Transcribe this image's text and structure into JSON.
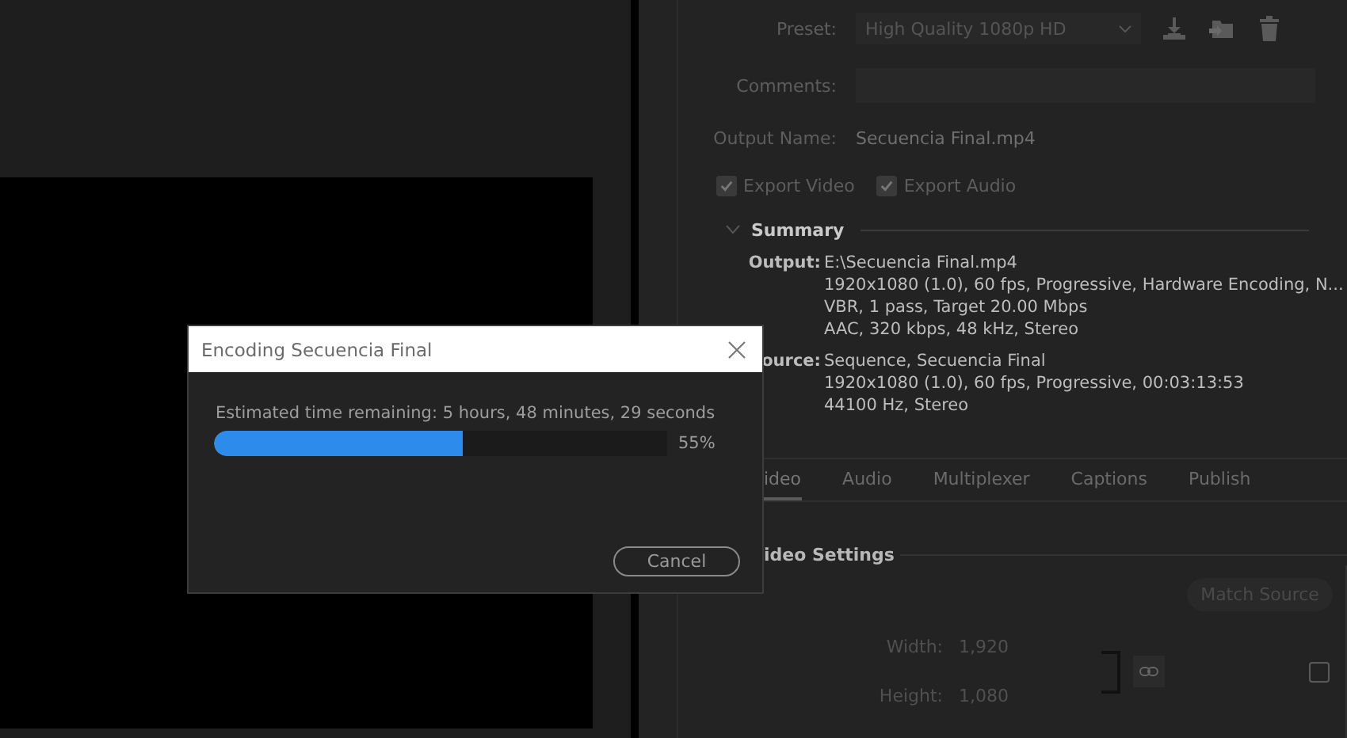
{
  "export_settings": {
    "preset": {
      "label": "Preset:",
      "value": "High Quality 1080p HD"
    },
    "comments": {
      "label": "Comments:"
    },
    "output_name": {
      "label": "Output Name:",
      "value": "Secuencia Final.mp4"
    },
    "exports": [
      {
        "label": "Export Video",
        "checked": true
      },
      {
        "label": "Export Audio",
        "checked": true
      }
    ]
  },
  "summary": {
    "title": "Summary",
    "expanded": true,
    "groups": [
      {
        "label": "Output:",
        "lines": [
          "E:\\Secuencia Final.mp4",
          "1920x1080 (1.0), 60 fps, Progressive, Hardware Encoding, N...",
          "VBR, 1 pass, Target 20.00 Mbps",
          "AAC, 320 kbps, 48 kHz, Stereo"
        ]
      },
      {
        "label": "ource:",
        "lines": [
          "Sequence, Secuencia Final",
          "1920x1080 (1.0), 60 fps, Progressive, 00:03:13:53",
          "44100 Hz, Stereo"
        ]
      }
    ]
  },
  "tabs": [
    {
      "label": "ideo",
      "selected": true
    },
    {
      "label": "Audio",
      "selected": false
    },
    {
      "label": "Multiplexer",
      "selected": false
    },
    {
      "label": "Captions",
      "selected": false
    },
    {
      "label": "Publish",
      "selected": false
    }
  ],
  "video_settings": {
    "title": "ideo Settings",
    "match_source": "Match Source",
    "width": {
      "label": "Width:",
      "value": "1,920"
    },
    "height": {
      "label": "Height:",
      "value": "1,080"
    },
    "checkbox": {
      "checked": false
    }
  },
  "dialog": {
    "title": "Encoding Secuencia Final",
    "message": "Estimated time remaining: 5 hours, 48 minutes, 29 seconds",
    "progress": {
      "level": 0.55,
      "reading": "55%"
    },
    "cancel": "Cancel"
  }
}
